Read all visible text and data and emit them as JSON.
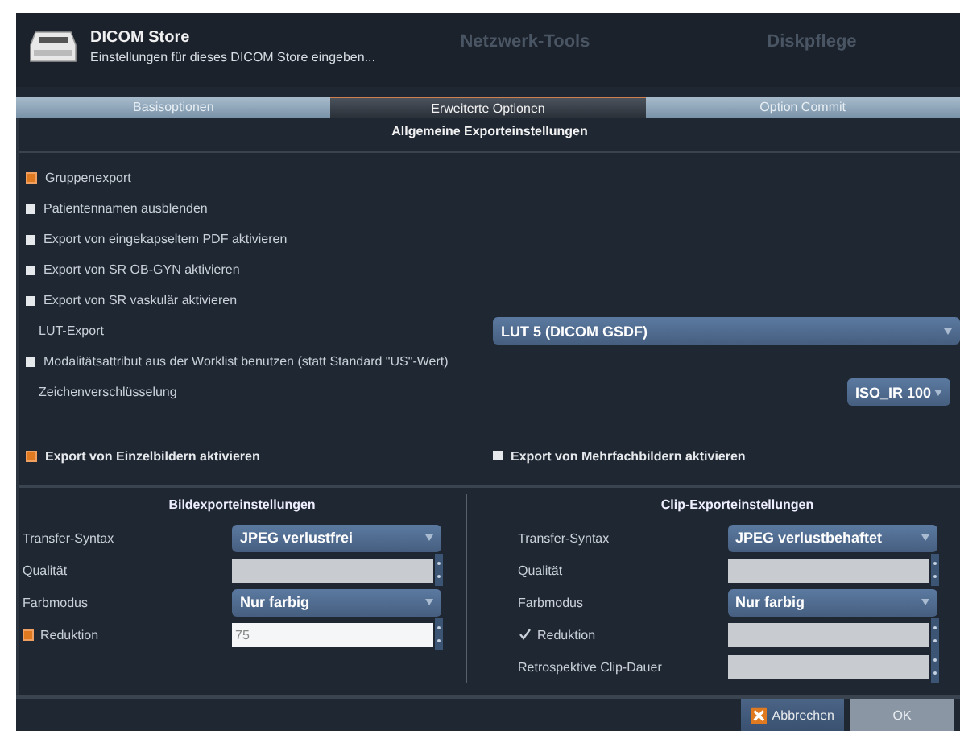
{
  "background_tabs": [
    "Netzwerk-Tools",
    "Diskpflege"
  ],
  "dialog": {
    "title": "DICOM Store",
    "subtitle": "Einstellungen für dieses DICOM Store eingeben..."
  },
  "tabs": [
    {
      "label": "Basisoptionen",
      "selected": false
    },
    {
      "label": "Erweiterte Optionen",
      "selected": true
    },
    {
      "label": "Option Commit",
      "selected": false
    }
  ],
  "section_title": "Allgemeine Exporteinstellungen",
  "options": [
    {
      "kind": "checkbox",
      "label": "Gruppenexport",
      "checked": true
    },
    {
      "kind": "checkbox",
      "label": "Patientennamen ausblenden",
      "checked": false
    },
    {
      "kind": "checkbox",
      "label": "Export von eingekapseltem PDF aktivieren",
      "checked": false
    },
    {
      "kind": "checkbox",
      "label": "Export von SR OB-GYN aktivieren",
      "checked": false
    },
    {
      "kind": "checkbox",
      "label": "Export von SR vaskulär aktivieren",
      "checked": false
    },
    {
      "kind": "wide-select",
      "label": "LUT-Export",
      "value": "LUT 5 (DICOM GSDF)"
    },
    {
      "kind": "checkbox",
      "label": "Modalitätsattribut aus der Worklist benutzen (statt Standard \"US\"-Wert)",
      "checked": false
    },
    {
      "kind": "small-select",
      "label": "Zeichenverschlüsselung",
      "value": "ISO_IR 100"
    }
  ],
  "export_toggles": [
    {
      "label": "Export von Einzelbildern aktivieren",
      "checked": true
    },
    {
      "label": "Export von Mehrfachbildern aktivieren",
      "checked": false
    }
  ],
  "panels": [
    {
      "title": "Bildexporteinstellungen",
      "rows": [
        {
          "kind": "select",
          "label": "Transfer-Syntax",
          "value": "JPEG verlustfrei"
        },
        {
          "kind": "spin",
          "label": "Qualität",
          "disabled": true
        },
        {
          "kind": "select",
          "label": "Farbmodus",
          "value": "Nur farbig"
        },
        {
          "kind": "check-spin",
          "label": "Reduktion",
          "checked": true,
          "value": "75",
          "disabled": false
        }
      ]
    },
    {
      "title": "Clip-Exporteinstellungen",
      "rows": [
        {
          "kind": "select",
          "label": "Transfer-Syntax",
          "value": "JPEG verlustbehaftet"
        },
        {
          "kind": "spin",
          "label": "Qualität",
          "disabled": true
        },
        {
          "kind": "select",
          "label": "Farbmodus",
          "value": "Nur farbig"
        },
        {
          "kind": "check-spin",
          "label": "Reduktion",
          "checked": true,
          "disabled": true
        },
        {
          "kind": "spin",
          "label": "Retrospektive Clip-Dauer",
          "disabled": true
        }
      ]
    }
  ],
  "buttons": [
    {
      "kind": "cancel",
      "label": "Abbrechen",
      "disabled": false
    },
    {
      "kind": "ok",
      "label": "OK",
      "disabled": true
    }
  ]
}
